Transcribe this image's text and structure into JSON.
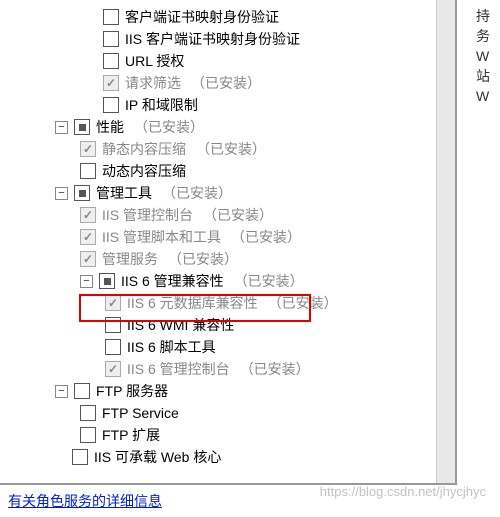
{
  "tree": {
    "security_items": [
      {
        "label": "客户端证书映射身份验证",
        "checked": false,
        "disabled": false
      },
      {
        "label": "IIS 客户端证书映射身份验证",
        "checked": false,
        "disabled": false
      },
      {
        "label": "URL 授权",
        "checked": false,
        "disabled": false
      },
      {
        "label": "请求筛选",
        "checked": true,
        "disabled": true,
        "installed": "（已安装）"
      },
      {
        "label": "IP 和域限制",
        "checked": false,
        "disabled": false
      }
    ],
    "performance": {
      "label": "性能",
      "installed": "（已安装）",
      "checked_style": "square",
      "items": [
        {
          "label": "静态内容压缩",
          "checked": true,
          "disabled": true,
          "installed": "（已安装）"
        },
        {
          "label": "动态内容压缩",
          "checked": false,
          "disabled": false
        }
      ]
    },
    "management": {
      "label": "管理工具",
      "installed": "（已安装）",
      "checked_style": "square",
      "items": [
        {
          "label": "IIS 管理控制台",
          "checked": true,
          "disabled": true,
          "installed": "（已安装）"
        },
        {
          "label": "IIS 管理脚本和工具",
          "checked": true,
          "disabled": true,
          "installed": "（已安装）"
        },
        {
          "label": "管理服务",
          "checked": true,
          "disabled": true,
          "installed": "（已安装）",
          "highlight": true
        }
      ],
      "iis6": {
        "label": "IIS 6 管理兼容性",
        "installed": "（已安装）",
        "checked_style": "square",
        "items": [
          {
            "label": "IIS 6 元数据库兼容性",
            "checked": true,
            "disabled": true,
            "installed": "（已安装）"
          },
          {
            "label": "IIS 6 WMI 兼容性",
            "checked": false,
            "disabled": false
          },
          {
            "label": "IIS 6 脚本工具",
            "checked": false,
            "disabled": false
          },
          {
            "label": "IIS 6 管理控制台",
            "checked": true,
            "disabled": true,
            "installed": "（已安装）"
          }
        ]
      }
    },
    "ftp": {
      "label": "FTP 服务器",
      "checked": false,
      "items": [
        {
          "label": "FTP Service",
          "checked": false
        },
        {
          "label": "FTP 扩展",
          "checked": false
        }
      ]
    },
    "hostable": {
      "label": "IIS 可承载 Web 核心",
      "checked": false
    }
  },
  "link": "有关角色服务的详细信息",
  "side_fragments": [
    "持",
    "务",
    "W",
    "站",
    "W"
  ],
  "watermark": "https://blog.csdn.net/jhycjhyc",
  "expander_minus": "−"
}
